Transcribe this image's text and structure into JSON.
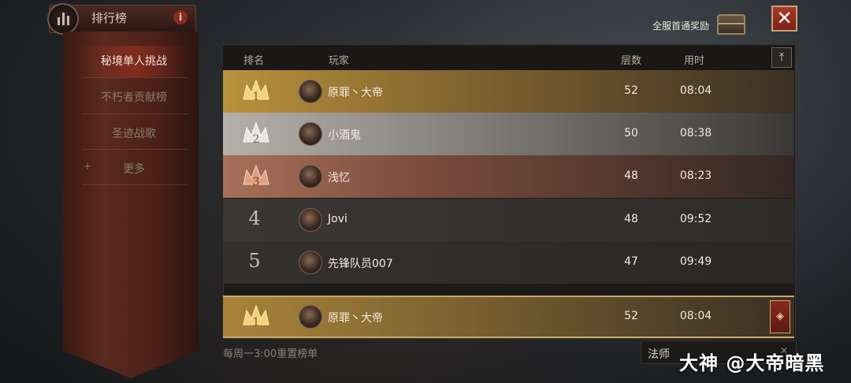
{
  "header": {
    "title": "排行榜",
    "info": "i"
  },
  "sidebar": {
    "items": [
      {
        "label": "秘境单人挑战"
      },
      {
        "label": "不朽者贡献榜"
      },
      {
        "label": "圣迹战歌"
      },
      {
        "label": "更多",
        "prefix": "+"
      }
    ]
  },
  "reward": {
    "label": "全服首通奖励"
  },
  "close": "✕",
  "table": {
    "columns": {
      "rank": "排名",
      "player": "玩家",
      "level": "层数",
      "time": "用时"
    },
    "top_button": "⤒",
    "rows": [
      {
        "rank": "1",
        "name": "原罪丶大帝",
        "level": "52",
        "time": "08:04"
      },
      {
        "rank": "2",
        "name": "小酒鬼",
        "level": "50",
        "time": "08:38"
      },
      {
        "rank": "3",
        "name": "浅忆",
        "level": "48",
        "time": "08:23"
      },
      {
        "rank": "4",
        "name": "Jovi",
        "level": "48",
        "time": "09:52"
      },
      {
        "rank": "5",
        "name": "先锋队员007",
        "level": "47",
        "time": "09:49"
      }
    ],
    "mine": {
      "rank": "1",
      "name": "原罪丶大帝",
      "level": "52",
      "time": "08:04"
    }
  },
  "footer": {
    "reset_note": "每周一3:00重置榜单",
    "class_value": "法师"
  },
  "watermark": "大神 @大帝暗黑",
  "colors": {
    "gold": "#b8923c",
    "silver": "#b4b0aa",
    "bronze": "#a8705a",
    "accent_red": "#8a2a1e"
  }
}
